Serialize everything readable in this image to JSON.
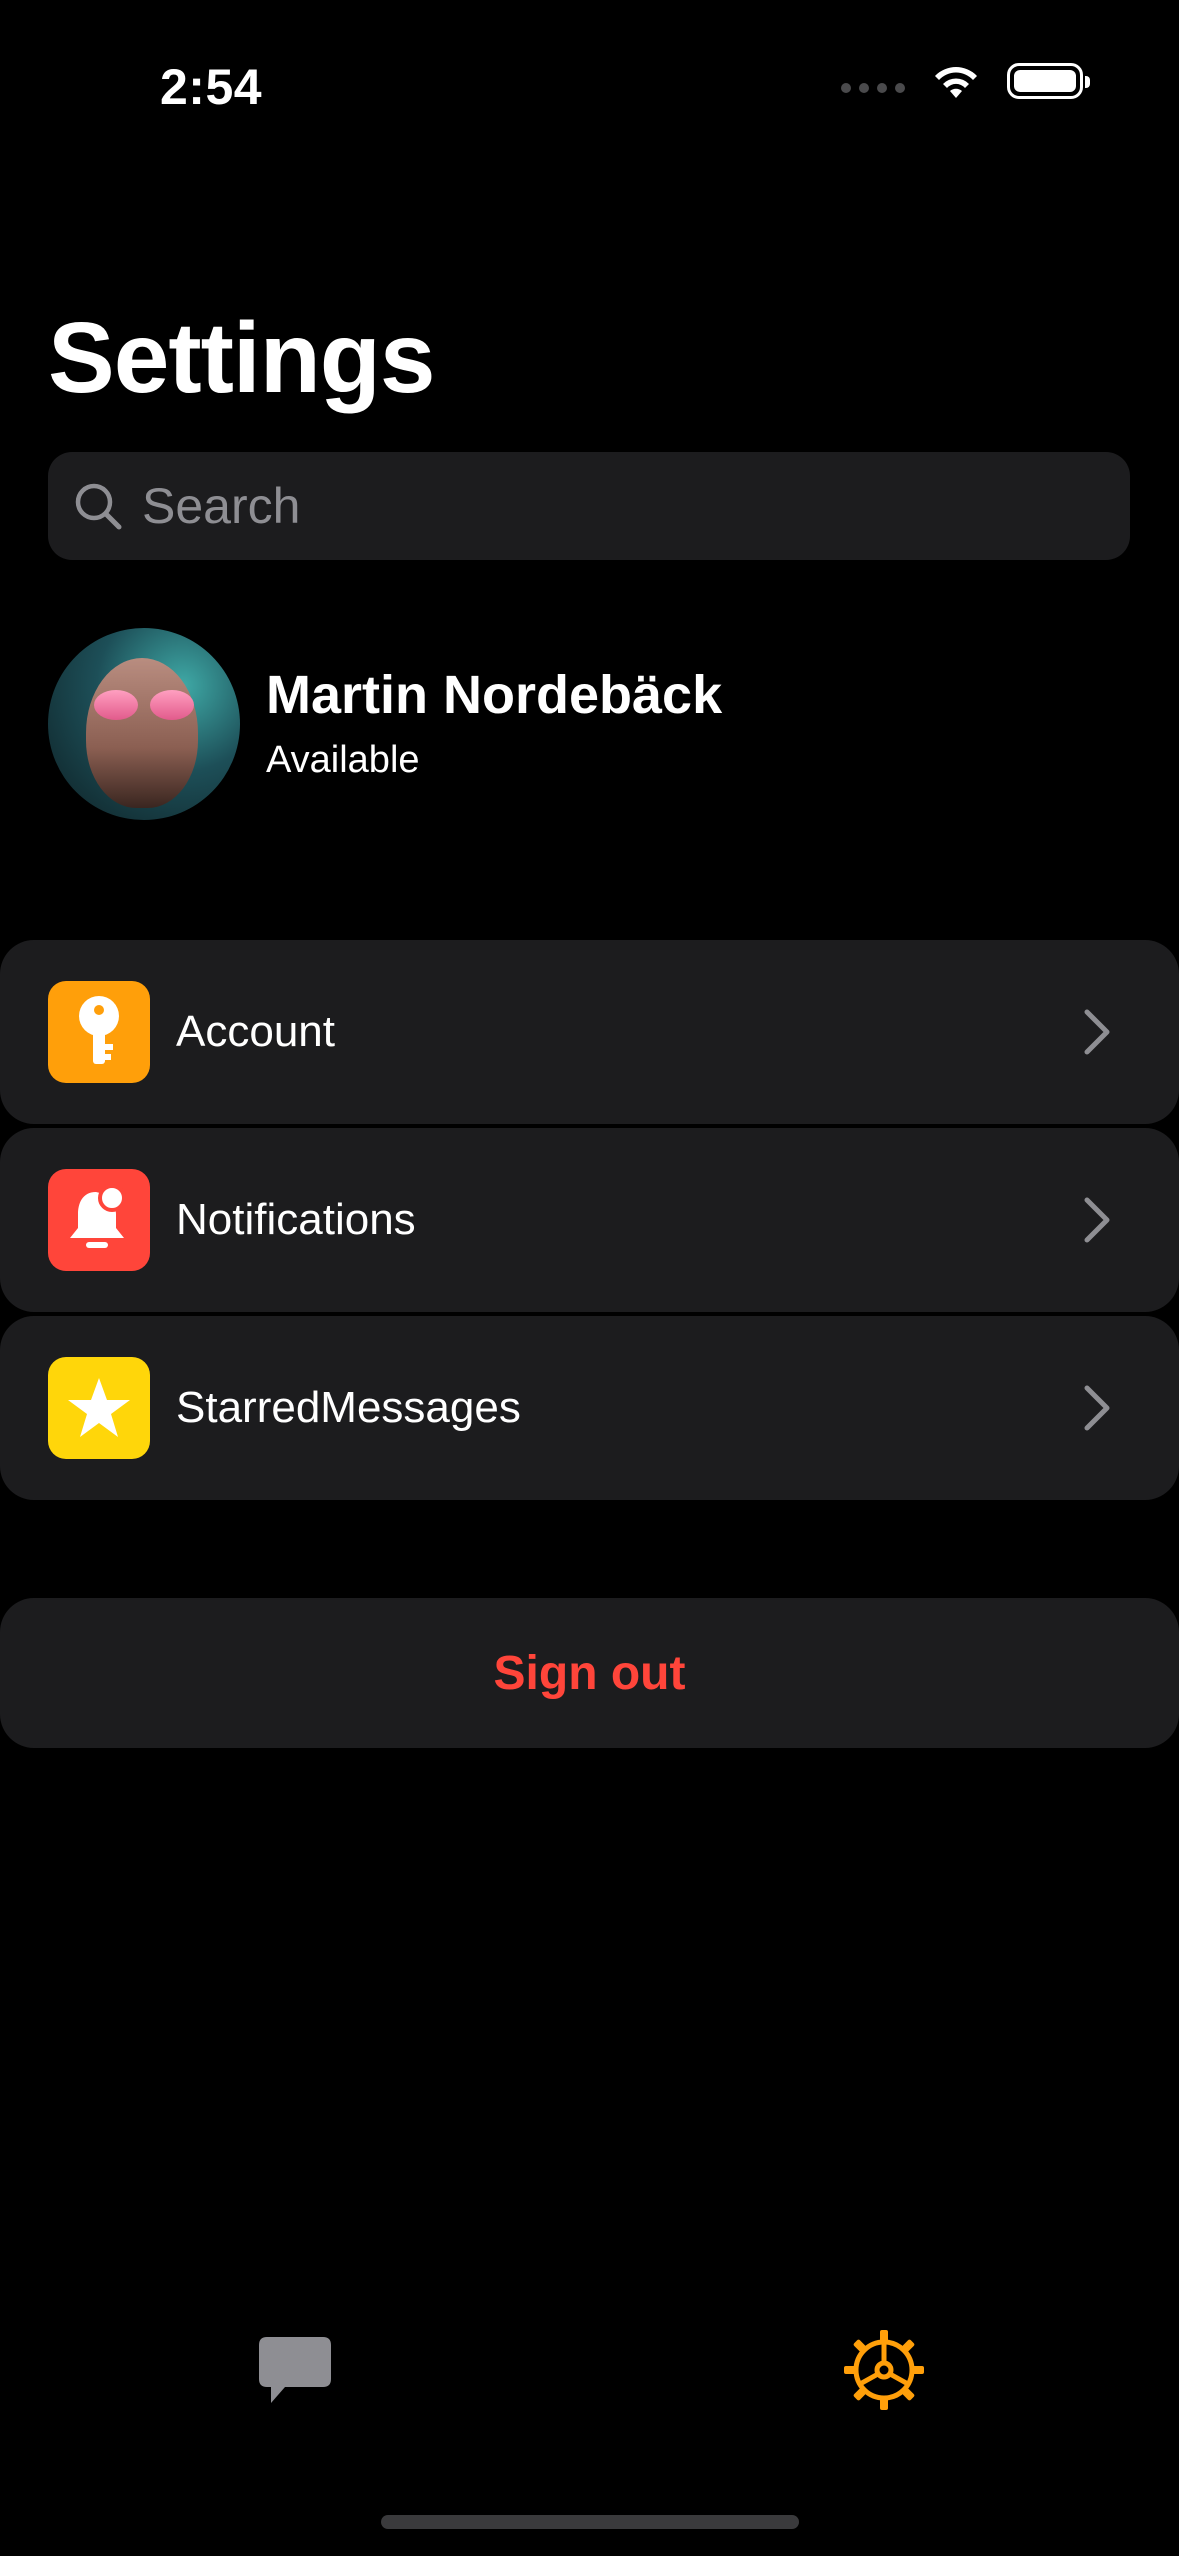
{
  "status_bar": {
    "time": "2:54"
  },
  "header": {
    "title": "Settings"
  },
  "search": {
    "placeholder": "Search",
    "value": ""
  },
  "profile": {
    "name": "Martin Nordebäck",
    "status": "Available"
  },
  "menu": {
    "items": [
      {
        "label": "Account",
        "icon": "key-icon",
        "color": "#ff9f0a"
      },
      {
        "label": "Notifications",
        "icon": "bell-badge-icon",
        "color": "#ff453a"
      },
      {
        "label": "StarredMessages",
        "icon": "star-icon",
        "color": "#ffd60a"
      }
    ]
  },
  "actions": {
    "sign_out_label": "Sign out",
    "sign_out_color": "#ff453a"
  },
  "tab_bar": {
    "tabs": [
      {
        "name": "chats",
        "icon": "chat-bubble-icon",
        "active": false
      },
      {
        "name": "settings",
        "icon": "gear-icon",
        "active": true
      }
    ],
    "active_color": "#ff9f0a",
    "inactive_color": "#8e8e93"
  }
}
